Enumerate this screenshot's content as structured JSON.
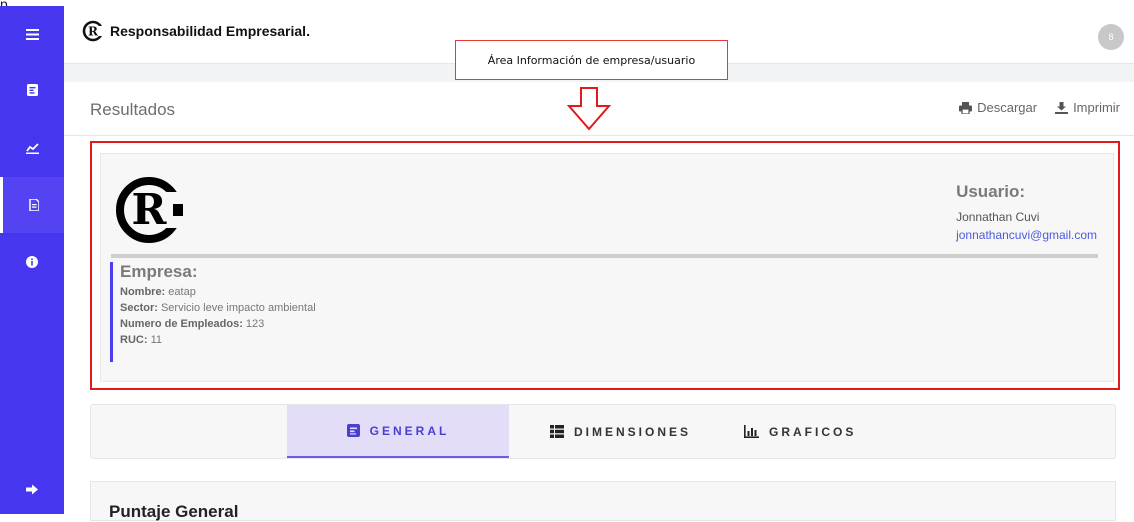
{
  "fragment_text": "p",
  "sidebar": {
    "items": [
      {
        "icon": "menu-icon"
      },
      {
        "icon": "form-icon"
      },
      {
        "icon": "chart-line-icon"
      },
      {
        "icon": "document-icon"
      },
      {
        "icon": "info-icon"
      },
      {
        "icon": "logout-icon"
      }
    ]
  },
  "topbar": {
    "brand_name": "Responsabilidad Empresarial.",
    "avatar_initial": "8"
  },
  "annotation": {
    "label": "Área Información de empresa/usuario"
  },
  "header": {
    "title": "Resultados",
    "download_label": "Descargar",
    "print_label": "Imprimir"
  },
  "user": {
    "title": "Usuario:",
    "name": "Jonnathan Cuvi",
    "email": "jonnathancuvi@gmail.com"
  },
  "company": {
    "title": "Empresa:",
    "fields": [
      {
        "label": "Nombre:",
        "value": "eatap"
      },
      {
        "label": "Sector:",
        "value": "Servicio leve impacto ambiental"
      },
      {
        "label": "Numero de Empleados:",
        "value": "123"
      },
      {
        "label": "RUC:",
        "value": "11"
      }
    ]
  },
  "tabs": [
    {
      "label": "GENERAL",
      "icon": "form-icon",
      "active": true
    },
    {
      "label": "DIMENSIONES",
      "icon": "list-icon",
      "active": false
    },
    {
      "label": "GRAFICOS",
      "icon": "bar-chart-icon",
      "active": false
    }
  ],
  "score": {
    "title": "Puntaje General"
  },
  "colors": {
    "sidebar": "#4736f0",
    "accent": "#6a5cf0",
    "annotation_red": "#e01b1b",
    "link": "#4b5be0"
  }
}
